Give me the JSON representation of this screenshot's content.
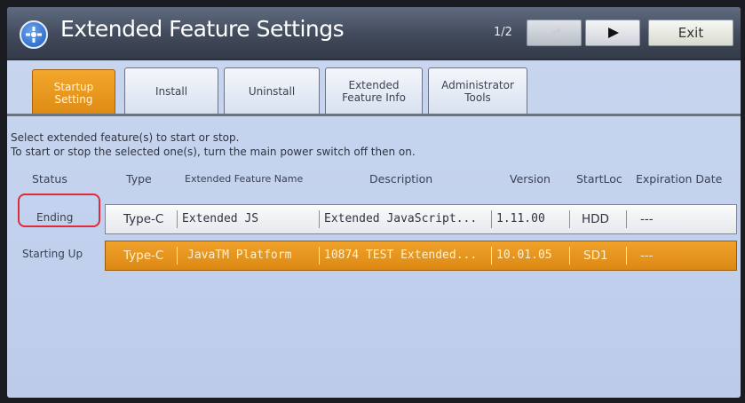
{
  "header": {
    "title": "Extended Feature Settings",
    "page_indicator": "1/2",
    "exit_label": "Exit"
  },
  "tabs": [
    {
      "label_line1": "Startup",
      "label_line2": "Setting",
      "active": true
    },
    {
      "label_line1": "Install",
      "label_line2": "",
      "active": false
    },
    {
      "label_line1": "Uninstall",
      "label_line2": "",
      "active": false
    },
    {
      "label_line1": "Extended",
      "label_line2": "Feature Info",
      "active": false
    },
    {
      "label_line1": "Administrator",
      "label_line2": "Tools",
      "active": false
    }
  ],
  "instructions": {
    "line1": "Select extended feature(s) to start or stop.",
    "line2": "To start or stop the selected one(s), turn the main power switch off then on."
  },
  "columns": {
    "status": "Status",
    "type": "Type",
    "name": "Extended Feature Name",
    "description": "Description",
    "version": "Version",
    "startloc": "StartLoc",
    "expiration": "Expiration Date"
  },
  "rows": [
    {
      "status": "Ending",
      "type": "Type-C",
      "name": "Extended JS",
      "description": "Extended JavaScript...",
      "version": "1.11.00",
      "startloc": "HDD",
      "expiration": "---",
      "selected": false
    },
    {
      "status": "Starting Up",
      "type": "Type-C",
      "name": "JavaTM Platform",
      "description": "10874 TEST Extended...",
      "version": "10.01.05",
      "startloc": "SD1",
      "expiration": "---",
      "selected": true
    }
  ],
  "colors": {
    "titlebar": "#414a5b",
    "active_tab": "#e8951d",
    "selected_row": "#e8951d",
    "background": "#c6d4ee",
    "highlight_circle": "#e0293a"
  },
  "icons": {
    "app": "extended-feature-gear-icon",
    "next": "play-right-icon",
    "prev": "play-left-icon"
  }
}
